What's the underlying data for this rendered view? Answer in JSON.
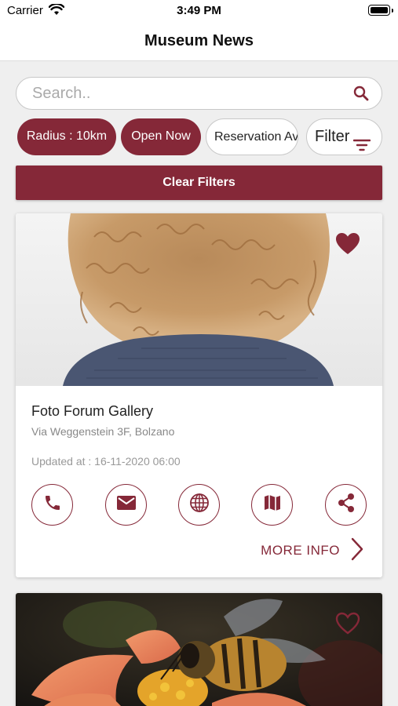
{
  "status_bar": {
    "carrier": "Carrier",
    "time": "3:49 PM"
  },
  "nav": {
    "title": "Museum News"
  },
  "search": {
    "placeholder": "Search..",
    "value": ""
  },
  "filters": {
    "radius": "Radius : 10km",
    "open_now": "Open Now",
    "reservation": "Reservation Av",
    "filter": "Filter"
  },
  "clear_filters": "Clear Filters",
  "cards": [
    {
      "title": "Foto Forum Gallery",
      "address": "Via Weggenstein 3F, Bolzano",
      "updated": "Updated at : 16-11-2020 06:00",
      "favorited": true,
      "more_info": "MORE INFO"
    },
    {
      "favorited": false
    }
  ],
  "colors": {
    "accent": "#852838",
    "background": "#efefef"
  },
  "icons": [
    "wifi-icon",
    "battery-icon",
    "search-icon",
    "filter-icon",
    "heart-icon",
    "phone-icon",
    "mail-icon",
    "globe-icon",
    "map-icon",
    "share-icon",
    "chevron-right-icon"
  ]
}
